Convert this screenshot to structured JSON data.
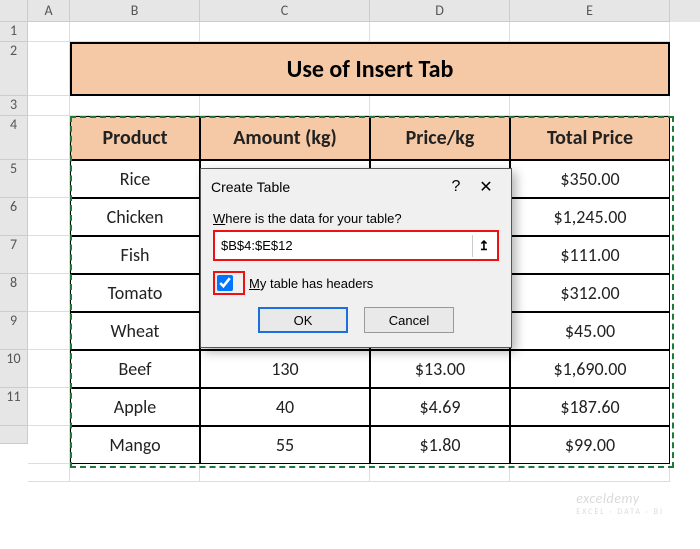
{
  "columnLetters": [
    "A",
    "B",
    "C",
    "D",
    "E"
  ],
  "rowNumbers": [
    "1",
    "2",
    "3",
    "4",
    "5",
    "6",
    "7",
    "8",
    "9",
    "10",
    "11"
  ],
  "title": "Use of Insert Tab",
  "headers": {
    "product": "Product",
    "amount": "Amount (kg)",
    "price": "Price/kg",
    "total": "Total Price"
  },
  "rows": [
    {
      "product": "Rice",
      "amount": "",
      "price": "",
      "total": "$350.00"
    },
    {
      "product": "Chicken",
      "amount": "",
      "price": "",
      "total": "$1,245.00"
    },
    {
      "product": "Fish",
      "amount": "",
      "price": "",
      "total": "$111.00"
    },
    {
      "product": "Tomato",
      "amount": "",
      "price": "",
      "total": "$312.00"
    },
    {
      "product": "Wheat",
      "amount": "",
      "price": "",
      "total": "$45.00"
    },
    {
      "product": "Beef",
      "amount": "130",
      "price": "$13.00",
      "total": "$1,690.00"
    },
    {
      "product": "Apple",
      "amount": "40",
      "price": "$4.69",
      "total": "$187.60"
    },
    {
      "product": "Mango",
      "amount": "55",
      "price": "$1.80",
      "total": "$99.00"
    }
  ],
  "dialog": {
    "title": "Create Table",
    "helpGlyph": "?",
    "closeGlyph": "✕",
    "whereLabelPre": "",
    "whereLabel": "Where is the data for your table?",
    "rangeValue": "$B$4:$E$12",
    "pickerGlyph": "↥",
    "headersChecked": true,
    "headersLabel": "My table has headers",
    "okLabel": "OK",
    "cancelLabel": "Cancel"
  },
  "watermark": {
    "main": "exceldemy",
    "sub": "EXCEL · DATA · BI"
  }
}
